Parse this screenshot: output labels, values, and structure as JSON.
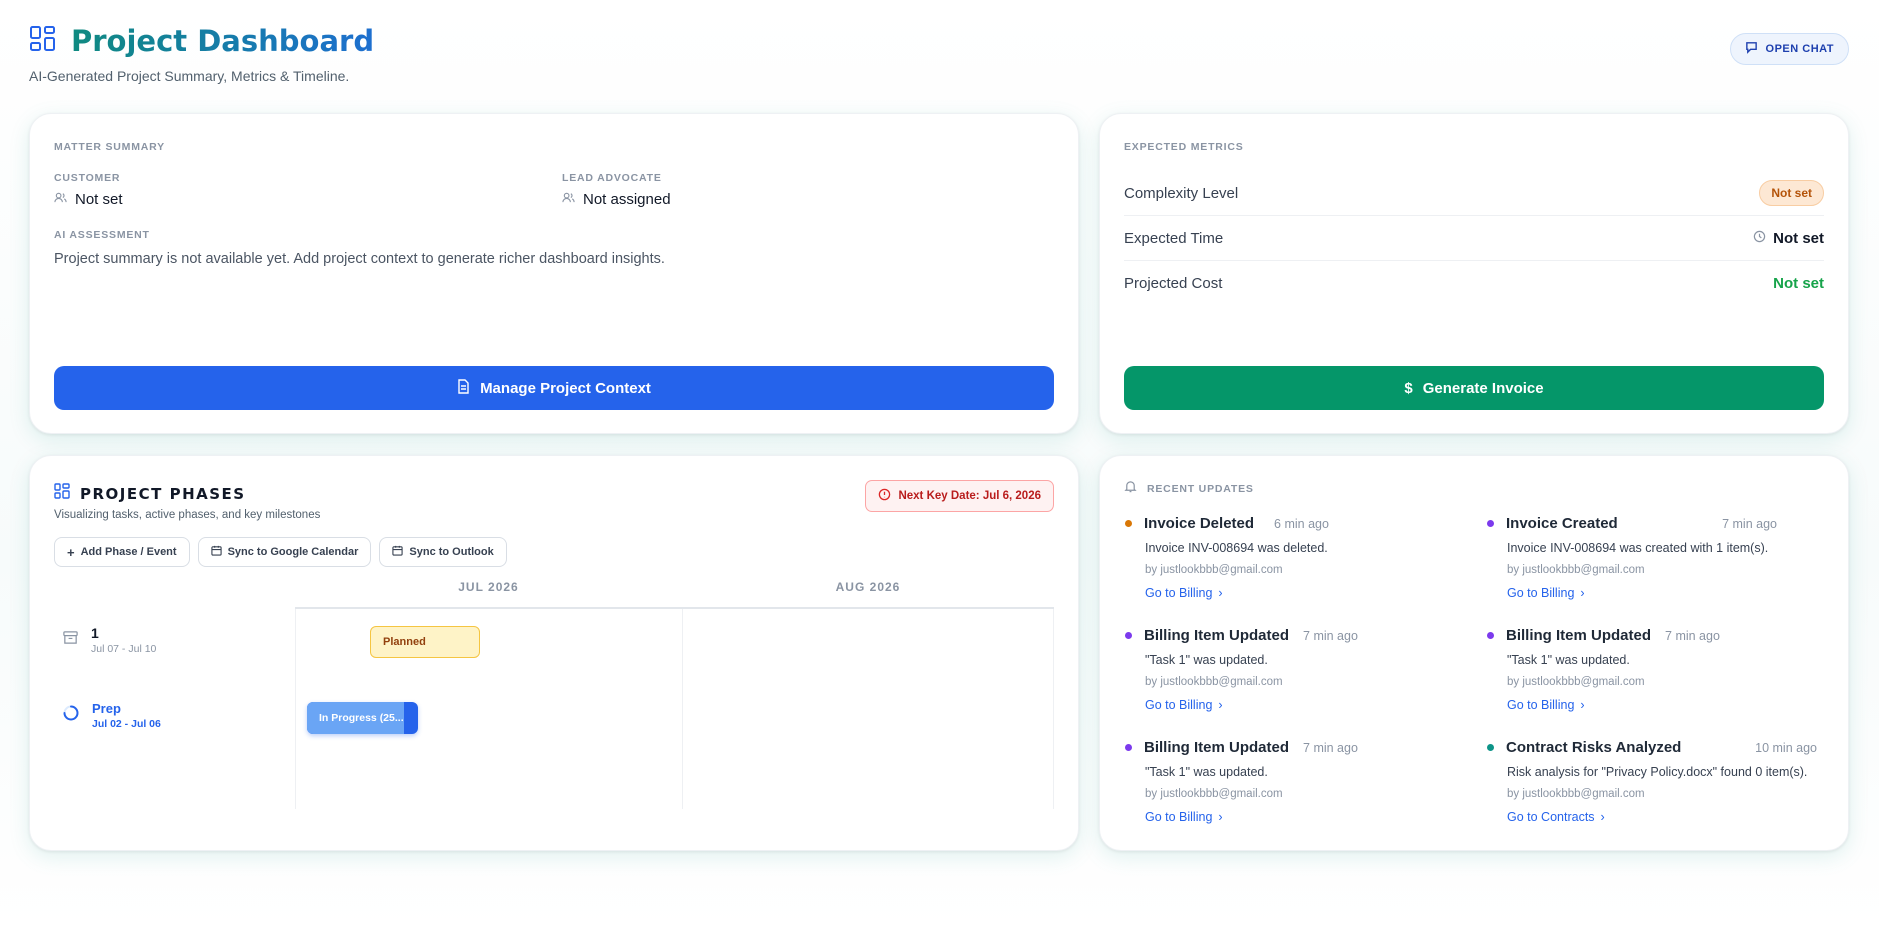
{
  "header": {
    "title": "Project Dashboard",
    "subtitle": "AI-Generated Project Summary, Metrics & Timeline.",
    "open_chat": "OPEN CHAT"
  },
  "matter": {
    "section_label": "MATTER SUMMARY",
    "customer_label": "CUSTOMER",
    "customer_value": "Not set",
    "advocate_label": "LEAD ADVOCATE",
    "advocate_value": "Not assigned",
    "assessment_label": "AI ASSESSMENT",
    "assessment_text": "Project summary is not available yet. Add project context to generate richer dashboard insights.",
    "button": "Manage Project Context",
    "button_color": "#2563eb"
  },
  "metrics": {
    "section_label": "EXPECTED METRICS",
    "complexity_label": "Complexity Level",
    "complexity_value": "Not set",
    "time_label": "Expected Time",
    "time_value": "Not set",
    "cost_label": "Projected Cost",
    "cost_value": "Not set",
    "button": "Generate Invoice",
    "button_color": "#059669"
  },
  "phases": {
    "title": "PROJECT PHASES",
    "subtitle": "Visualizing tasks, active phases, and key milestones",
    "key_date": "Next Key Date: Jul 6, 2026",
    "add_button": "Add Phase / Event",
    "google_button": "Sync to Google Calendar",
    "outlook_button": "Sync to Outlook",
    "months": [
      "JUL 2026",
      "AUG 2026"
    ],
    "rows": [
      {
        "name": "1",
        "dates": "Jul 07 - Jul 10",
        "bar_label": "Planned",
        "icon": "archive-icon"
      },
      {
        "name": "Prep",
        "dates": "Jul 02 - Jul 06",
        "bar_label": "In Progress (25...",
        "icon": "spinner-icon"
      }
    ]
  },
  "updates": {
    "section_label": "RECENT UPDATES",
    "items": [
      {
        "title": "Invoice Deleted",
        "time": "6 min ago",
        "desc": "Invoice INV-008694 was deleted.",
        "by": "by justlookbbb@gmail.com",
        "link": "Go to Billing",
        "dot": "#d97706"
      },
      {
        "title": "Invoice Created",
        "time": "7 min ago",
        "desc": "Invoice INV-008694 was created with 1 item(s).",
        "by": "by justlookbbb@gmail.com",
        "link": "Go to Billing",
        "dot": "#7c3aed"
      },
      {
        "title": "Billing Item Updated",
        "time": "7 min ago",
        "desc": "\"Task 1\" was updated.",
        "by": "by justlookbbb@gmail.com",
        "link": "Go to Billing",
        "dot": "#7c3aed"
      },
      {
        "title": "Billing Item Updated",
        "time": "7 min ago",
        "desc": "\"Task 1\" was updated.",
        "by": "by justlookbbb@gmail.com",
        "link": "Go to Billing",
        "dot": "#7c3aed"
      },
      {
        "title": "Billing Item Updated",
        "time": "7 min ago",
        "desc": "\"Task 1\" was updated.",
        "by": "by justlookbbb@gmail.com",
        "link": "Go to Billing",
        "dot": "#7c3aed"
      },
      {
        "title": "Contract Risks Analyzed",
        "time": "10 min ago",
        "desc": "Risk analysis for \"Privacy Policy.docx\" found 0 item(s).",
        "by": "by justlookbbb@gmail.com",
        "link": "Go to Contracts",
        "dot": "#0d9488"
      }
    ]
  }
}
